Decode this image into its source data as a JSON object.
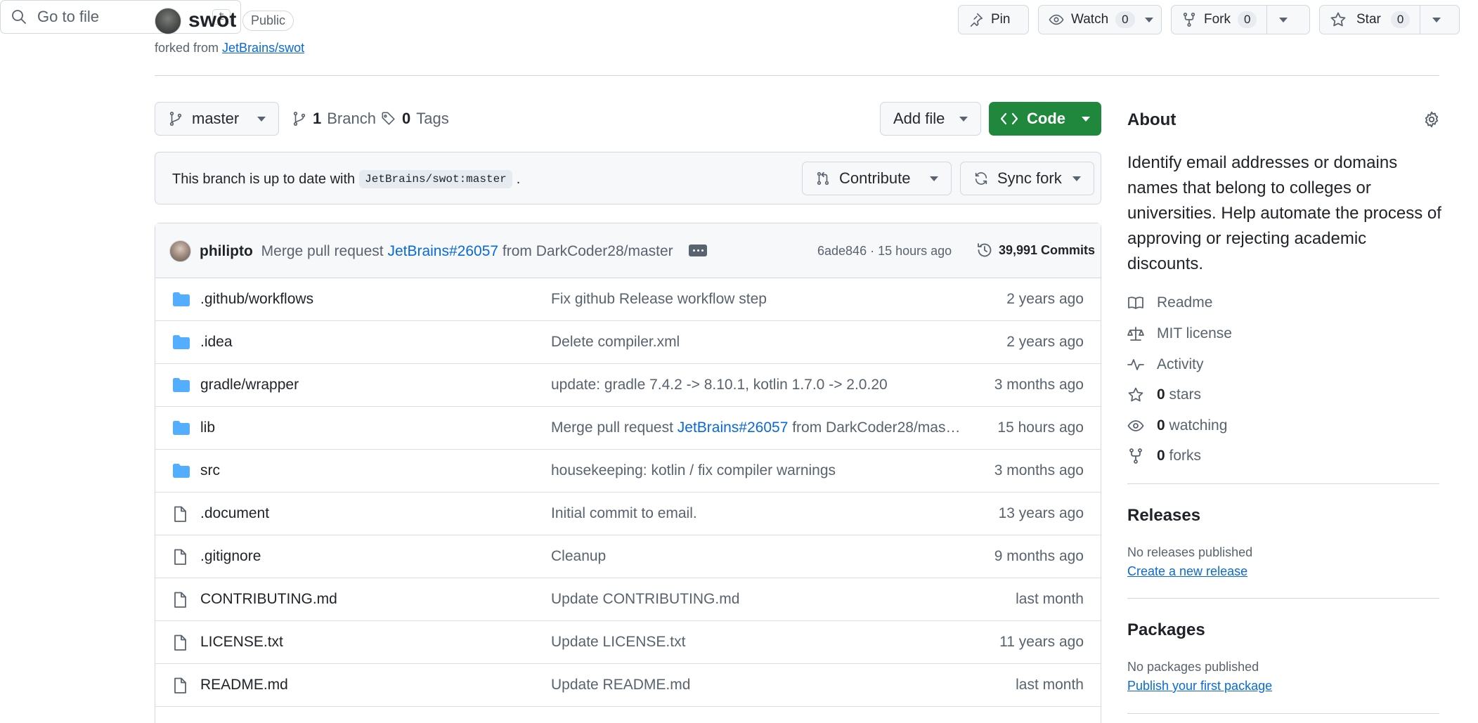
{
  "repo": {
    "name": "swot",
    "visibility": "Public",
    "forked_prefix": "forked from",
    "forked_from": "JetBrains/swot"
  },
  "header_actions": {
    "pin": "Pin",
    "watch": "Watch",
    "watch_count": "0",
    "fork": "Fork",
    "fork_count": "0",
    "star": "Star",
    "star_count": "0"
  },
  "toolbar": {
    "branch": "master",
    "branches_count": "1",
    "branches_label": "Branch",
    "tags_count": "0",
    "tags_label": "Tags",
    "search_placeholder": "Go to file",
    "search_shortcut": "t",
    "add_file": "Add file",
    "code": "Code"
  },
  "banner": {
    "text": "This branch is up to date with",
    "ref": "JetBrains/swot:master",
    "suffix": ".",
    "contribute": "Contribute",
    "sync_fork": "Sync fork"
  },
  "latest_commit": {
    "author": "philipto",
    "message_prefix": "Merge pull request",
    "pr_link": "JetBrains#26057",
    "message_suffix": "from DarkCoder28/master",
    "meta": "6ade846 · 15 hours ago",
    "commits": "39,991 Commits"
  },
  "files": [
    {
      "type": "dir",
      "name": ".github/workflows",
      "msg": "Fix github Release workflow step",
      "link": "",
      "msg_suffix": "",
      "when": "2 years ago"
    },
    {
      "type": "dir",
      "name": ".idea",
      "msg": "Delete compiler.xml",
      "link": "",
      "msg_suffix": "",
      "when": "2 years ago"
    },
    {
      "type": "dir",
      "name": "gradle/wrapper",
      "msg": "update: gradle 7.4.2 -> 8.10.1, kotlin 1.7.0 -> 2.0.20",
      "link": "",
      "msg_suffix": "",
      "when": "3 months ago"
    },
    {
      "type": "dir",
      "name": "lib",
      "msg": "Merge pull request ",
      "link": "JetBrains#26057",
      "msg_suffix": " from DarkCoder28/mas…",
      "when": "15 hours ago"
    },
    {
      "type": "dir",
      "name": "src",
      "msg": "housekeeping: kotlin / fix compiler warnings",
      "link": "",
      "msg_suffix": "",
      "when": "3 months ago"
    },
    {
      "type": "file",
      "name": ".document",
      "msg": "Initial commit to email.",
      "link": "",
      "msg_suffix": "",
      "when": "13 years ago"
    },
    {
      "type": "file",
      "name": ".gitignore",
      "msg": "Cleanup",
      "link": "",
      "msg_suffix": "",
      "when": "9 months ago"
    },
    {
      "type": "file",
      "name": "CONTRIBUTING.md",
      "msg": "Update CONTRIBUTING.md",
      "link": "",
      "msg_suffix": "",
      "when": "last month"
    },
    {
      "type": "file",
      "name": "LICENSE.txt",
      "msg": "Update LICENSE.txt",
      "link": "",
      "msg_suffix": "",
      "when": "11 years ago"
    },
    {
      "type": "file",
      "name": "README.md",
      "msg": "Update README.md",
      "link": "",
      "msg_suffix": "",
      "when": "last month"
    }
  ],
  "about": {
    "title": "About",
    "description": "Identify email addresses or domains names that belong to colleges or universities. Help automate the process of approving or rejecting academic discounts.",
    "readme": "Readme",
    "license": "MIT license",
    "activity": "Activity",
    "stars_count": "0",
    "stars_label": "stars",
    "watching_count": "0",
    "watching_label": "watching",
    "forks_count": "0",
    "forks_label": "forks"
  },
  "releases": {
    "title": "Releases",
    "empty": "No releases published",
    "link": "Create a new release"
  },
  "packages": {
    "title": "Packages",
    "empty": "No packages published",
    "link": "Publish your first package"
  },
  "colors": {
    "accent_blue": "#0969da",
    "code_green": "#1f883d",
    "folder_blue": "#54aeff"
  }
}
